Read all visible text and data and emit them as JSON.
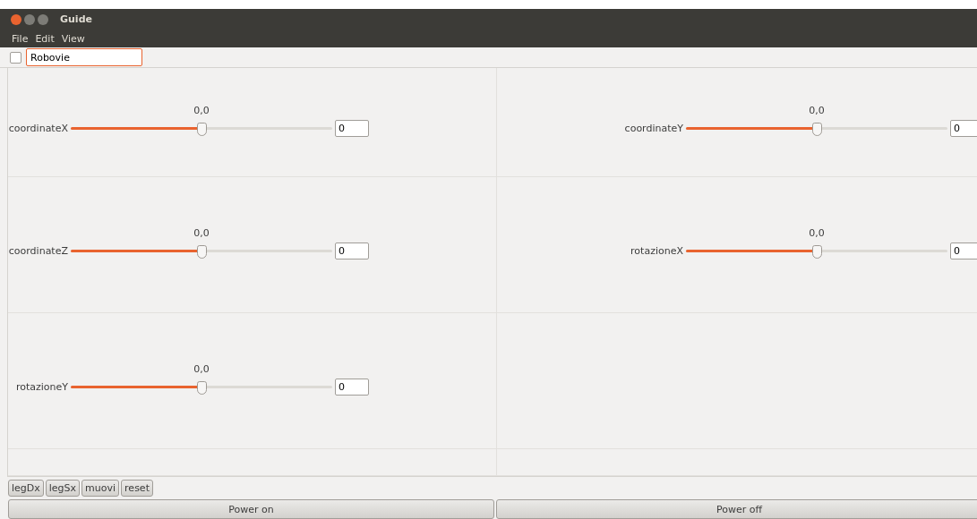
{
  "window": {
    "title": "Guide"
  },
  "menu": [
    "File",
    "Edit",
    "View"
  ],
  "header": {
    "checked": false,
    "name": "Robovie"
  },
  "sliders": [
    {
      "label": "coordinateX",
      "reading": "0,0",
      "level": 0.5,
      "value": "0"
    },
    {
      "label": "coordinateY",
      "reading": "0,0",
      "level": 0.5,
      "value": "0"
    },
    {
      "label": "coordinateZ",
      "reading": "0,0",
      "level": 0.5,
      "value": "0"
    },
    {
      "label": "rotazioneX",
      "reading": "0,0",
      "level": 0.5,
      "value": "0"
    },
    {
      "label": "rotazioneY",
      "reading": "0,0",
      "level": 0.5,
      "value": "0"
    }
  ],
  "actions": [
    "legDx",
    "legSx",
    "muovi",
    "reset"
  ],
  "power": [
    "Power on",
    "Power off"
  ]
}
